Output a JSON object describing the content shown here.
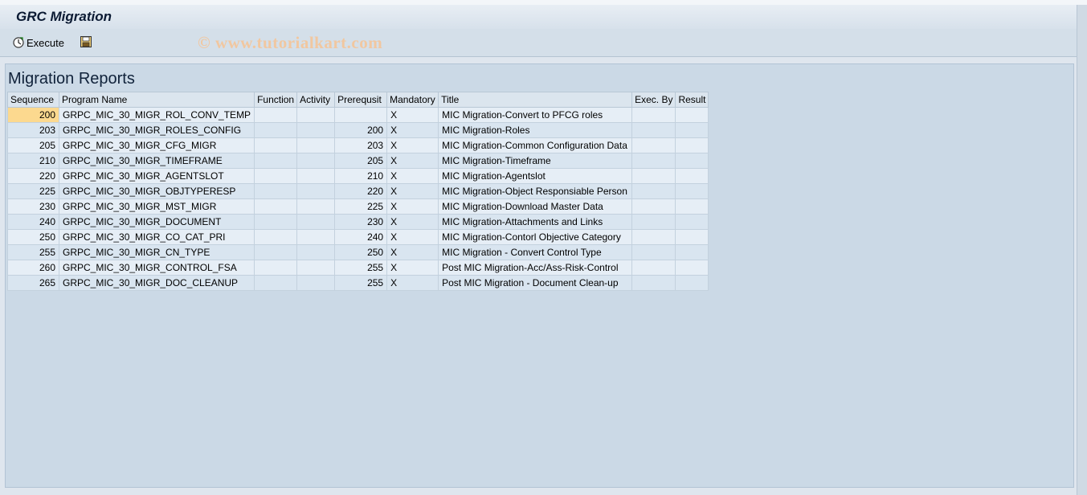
{
  "app": {
    "title": "GRC Migration"
  },
  "toolbar": {
    "execute_label": "Execute"
  },
  "watermark": "© www.tutorialkart.com",
  "panel": {
    "title": "Migration Reports"
  },
  "table": {
    "columns": [
      "Sequence",
      "Program Name",
      "Function",
      "Activity",
      "Prerequsit",
      "Mandatory",
      "Title",
      "Exec. By",
      "Result"
    ],
    "rows": [
      [
        "200",
        "GRPC_MIC_30_MIGR_ROL_CONV_TEMP",
        "",
        "",
        "",
        "X",
        "MIC Migration-Convert to PFCG roles",
        "",
        ""
      ],
      [
        "203",
        "GRPC_MIC_30_MIGR_ROLES_CONFIG",
        "",
        "",
        "200",
        "X",
        "MIC Migration-Roles",
        "",
        ""
      ],
      [
        "205",
        "GRPC_MIC_30_MIGR_CFG_MIGR",
        "",
        "",
        "203",
        "X",
        "MIC Migration-Common Configuration Data",
        "",
        ""
      ],
      [
        "210",
        "GRPC_MIC_30_MIGR_TIMEFRAME",
        "",
        "",
        "205",
        "X",
        "MIC Migration-Timeframe",
        "",
        ""
      ],
      [
        "220",
        "GRPC_MIC_30_MIGR_AGENTSLOT",
        "",
        "",
        "210",
        "X",
        "MIC Migration-Agentslot",
        "",
        ""
      ],
      [
        "225",
        "GRPC_MIC_30_MIGR_OBJTYPERESP",
        "",
        "",
        "220",
        "X",
        "MIC Migration-Object Responsiable Person",
        "",
        ""
      ],
      [
        "230",
        "GRPC_MIC_30_MIGR_MST_MIGR",
        "",
        "",
        "225",
        "X",
        "MIC Migration-Download Master Data",
        "",
        ""
      ],
      [
        "240",
        "GRPC_MIC_30_MIGR_DOCUMENT",
        "",
        "",
        "230",
        "X",
        "MIC Migration-Attachments and Links",
        "",
        ""
      ],
      [
        "250",
        "GRPC_MIC_30_MIGR_CO_CAT_PRI",
        "",
        "",
        "240",
        "X",
        "MIC Migration-Contorl Objective Category",
        "",
        ""
      ],
      [
        "255",
        "GRPC_MIC_30_MIGR_CN_TYPE",
        "",
        "",
        "250",
        "X",
        "MIC Migration - Convert Control Type",
        "",
        ""
      ],
      [
        "260",
        "GRPC_MIC_30_MIGR_CONTROL_FSA",
        "",
        "",
        "255",
        "X",
        "Post MIC Migration-Acc/Ass-Risk-Control",
        "",
        ""
      ],
      [
        "265",
        "GRPC_MIC_30_MIGR_DOC_CLEANUP",
        "",
        "",
        "255",
        "X",
        "Post MIC Migration - Document Clean-up",
        "",
        ""
      ]
    ]
  }
}
